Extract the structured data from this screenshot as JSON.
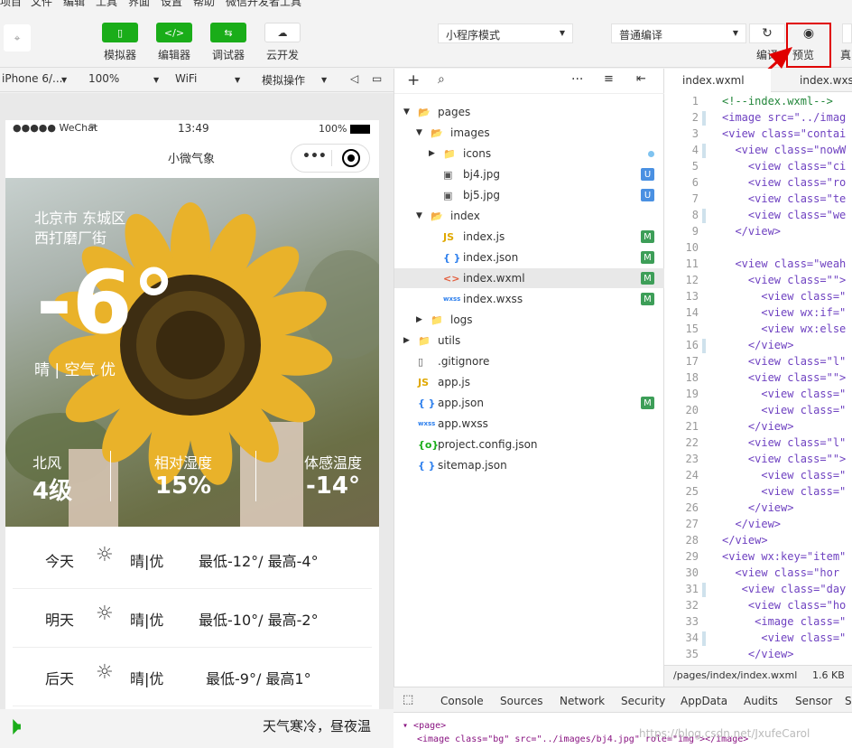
{
  "menubar": {
    "items": [
      "项目",
      "文件",
      "编辑",
      "工具",
      "界面",
      "设置",
      "帮助",
      "微信开发者工具"
    ]
  },
  "toolbar": {
    "buttons": [
      {
        "label": "模拟器",
        "icon": "phone-icon"
      },
      {
        "label": "编辑器",
        "icon": "code-icon"
      },
      {
        "label": "调试器",
        "icon": "debug-icon"
      },
      {
        "label": "云开发",
        "icon": "cloud-icon"
      }
    ],
    "mode_select": "小程序模式",
    "compile_select": "普通编译",
    "compile_label": "编译",
    "preview_label": "预览",
    "real_label": "真"
  },
  "sim_bar": {
    "device": "iPhone 6/...",
    "zoom": "100%",
    "network": "WiFi",
    "simulate": "模拟操作"
  },
  "phone": {
    "carrier": "●●●●● WeChat",
    "time": "13:49",
    "battery": "100%",
    "title": "小微气象",
    "location_line1": "北京市 东城区",
    "location_line2": "西打磨厂街",
    "temperature": "-6°",
    "condition": "晴 | 空气 优",
    "stats": [
      {
        "label": "北风",
        "value": "4级"
      },
      {
        "label": "相对湿度",
        "value": "15%"
      },
      {
        "label": "体感温度",
        "value": "-14°"
      }
    ],
    "forecast": [
      {
        "day": "今天",
        "cond": "晴|优",
        "range": "最低-12°/ 最高-4°"
      },
      {
        "day": "明天",
        "cond": "晴|优",
        "range": "最低-10°/ 最高-2°"
      },
      {
        "day": "后天",
        "cond": "晴|优",
        "range": "最低-9°/ 最高1°"
      }
    ],
    "tip": "天气寒冷，昼夜温"
  },
  "filetree": {
    "items": [
      {
        "label": "pages",
        "type": "folder-open",
        "indent": 0,
        "badge": ""
      },
      {
        "label": "images",
        "type": "folder-open",
        "indent": 1,
        "badge": ""
      },
      {
        "label": "icons",
        "type": "folder",
        "indent": 2,
        "badge": "dot"
      },
      {
        "label": "bj4.jpg",
        "type": "image",
        "indent": 2,
        "badge": "U"
      },
      {
        "label": "bj5.jpg",
        "type": "image",
        "indent": 2,
        "badge": "U"
      },
      {
        "label": "index",
        "type": "folder-open",
        "indent": 1,
        "badge": ""
      },
      {
        "label": "index.js",
        "type": "js",
        "indent": 2,
        "badge": "M"
      },
      {
        "label": "index.json",
        "type": "json",
        "indent": 2,
        "badge": "M"
      },
      {
        "label": "index.wxml",
        "type": "wxml",
        "indent": 2,
        "badge": "M"
      },
      {
        "label": "index.wxss",
        "type": "wxss",
        "indent": 2,
        "badge": "M"
      },
      {
        "label": "logs",
        "type": "folder",
        "indent": 1,
        "badge": ""
      },
      {
        "label": "utils",
        "type": "folder",
        "indent": 0,
        "badge": ""
      },
      {
        "label": ".gitignore",
        "type": "file",
        "indent": 0,
        "badge": ""
      },
      {
        "label": "app.js",
        "type": "js",
        "indent": 0,
        "badge": ""
      },
      {
        "label": "app.json",
        "type": "json",
        "indent": 0,
        "badge": "M"
      },
      {
        "label": "app.wxss",
        "type": "wxss",
        "indent": 0,
        "badge": ""
      },
      {
        "label": "project.config.json",
        "type": "config",
        "indent": 0,
        "badge": ""
      },
      {
        "label": "sitemap.json",
        "type": "json",
        "indent": 0,
        "badge": ""
      }
    ]
  },
  "editor": {
    "tabs": [
      "index.wxml",
      "index.wxs"
    ],
    "lines": [
      "<!--index.wxml-->",
      "<image src=\"../imag",
      "<view class=\"contai",
      "  <view class=\"nowW",
      "    <view class=\"ci",
      "    <view class=\"ro",
      "    <view class=\"te",
      "    <view class=\"we",
      "  </view>",
      "",
      "  <view class=\"weah",
      "    <view class=\"\">",
      "      <view class=\"",
      "      <view wx:if=\"",
      "      <view wx:else",
      "    </view>",
      "    <view class=\"l\"",
      "    <view class=\"\">",
      "      <view class=\"",
      "      <view class=\"",
      "    </view>",
      "    <view class=\"l\"",
      "    <view class=\"\">",
      "      <view class=\"",
      "      <view class=\"",
      "    </view>",
      "  </view>",
      "</view>",
      "<view wx:key=\"item\"",
      "  <view class=\"hor",
      "   <view class=\"day",
      "    <view class=\"ho",
      "     <image class=\"",
      "      <view class=\"",
      "    </view>"
    ],
    "path": "/pages/index/index.wxml",
    "size": "1.6 KB"
  },
  "devtools": {
    "tabs": [
      "Console",
      "Sources",
      "Network",
      "Security",
      "AppData",
      "Audits",
      "Sensor",
      "S"
    ],
    "line1": "<page>",
    "line2": "<image class=\"bg\" src=\"../images/bj4.jpg\" role=\"img\"></image>",
    "watermark": "https://blog.csdn.net/JxufeCarol"
  },
  "colors": {
    "accent": "#1aad19",
    "highlight": "#e00000",
    "badge_u": "#4a90e2",
    "badge_m": "#3d9e58"
  }
}
